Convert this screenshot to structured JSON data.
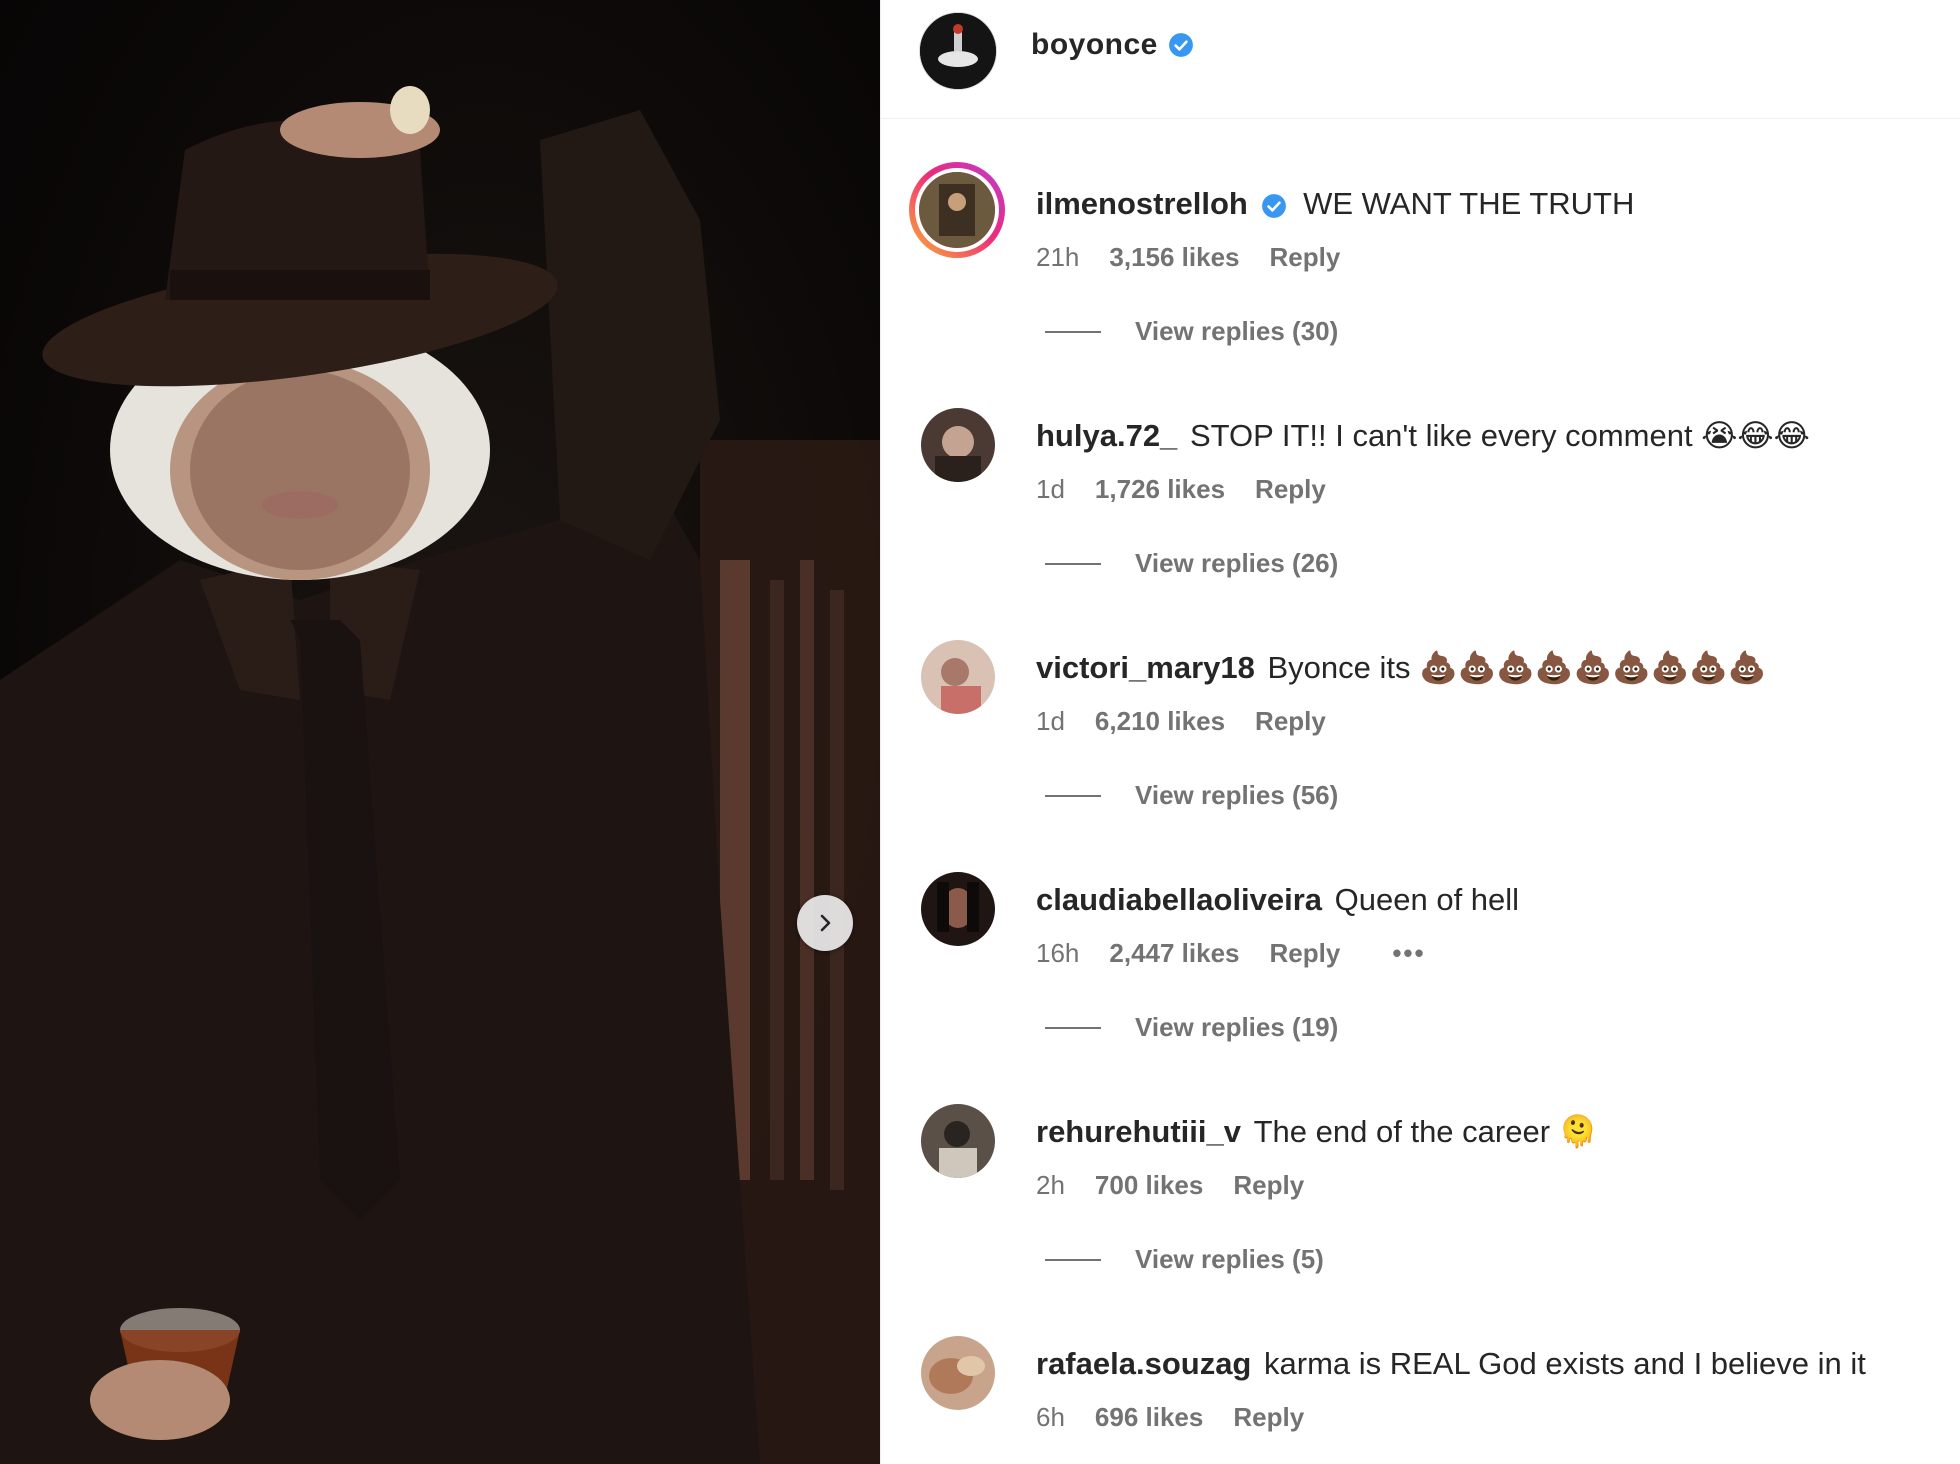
{
  "post": {
    "author": "boyonce",
    "verified": true,
    "carousel_next_icon": "chevron-right-icon"
  },
  "comments": [
    {
      "username": "ilmenostrelloh",
      "verified": true,
      "text": "WE WANT THE TRUTH",
      "time": "21h",
      "likes": "3,156 likes",
      "reply_label": "Reply",
      "view_replies": "View replies (30)",
      "story_ring": true
    },
    {
      "username": "hulya.72_",
      "verified": false,
      "text": "STOP IT!! I can't like every comment 😭😂😂",
      "time": "1d",
      "likes": "1,726 likes",
      "reply_label": "Reply",
      "view_replies": "View replies (26)",
      "story_ring": false
    },
    {
      "username": "victori_mary18",
      "verified": false,
      "text": "Byonce its 💩💩💩💩💩💩💩💩💩",
      "time": "1d",
      "likes": "6,210 likes",
      "reply_label": "Reply",
      "view_replies": "View replies (56)",
      "story_ring": false
    },
    {
      "username": "claudiabellaoliveira",
      "verified": false,
      "text": "Queen of hell",
      "time": "16h",
      "likes": "2,447 likes",
      "reply_label": "Reply",
      "more_label": "•••",
      "view_replies": "View replies (19)",
      "story_ring": false
    },
    {
      "username": "rehurehutiii_v",
      "verified": false,
      "text": "The end of the career 🫠",
      "time": "2h",
      "likes": "700 likes",
      "reply_label": "Reply",
      "view_replies": "View replies (5)",
      "story_ring": false
    },
    {
      "username": "rafaela.souzag",
      "verified": false,
      "text": "karma is REAL God exists and I believe in it",
      "time": "6h",
      "likes": "696 likes",
      "reply_label": "Reply",
      "story_ring": false
    }
  ],
  "colors": {
    "text_primary": "#262626",
    "text_secondary": "#737373",
    "verified_blue": "#3897f0",
    "divider": "#efefef"
  }
}
